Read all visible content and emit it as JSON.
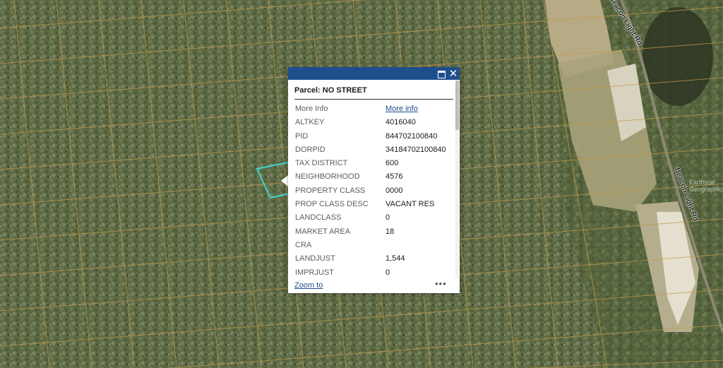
{
  "map": {
    "roads": [
      "Beacon Light Rd",
      "Beacon Light Rd"
    ],
    "credit": "Earthstar Geographics"
  },
  "popup": {
    "title": "Parcel: NO STREET",
    "rows": [
      {
        "key": "More Info",
        "value": "More info",
        "link": true
      },
      {
        "key": "ALTKEY",
        "value": "4016040"
      },
      {
        "key": "PID",
        "value": "844702100840"
      },
      {
        "key": "DORPID",
        "value": "34184702100840"
      },
      {
        "key": "TAX DISTRICT",
        "value": "600"
      },
      {
        "key": "NEIGHBORHOOD",
        "value": "4576"
      },
      {
        "key": "PROPERTY CLASS",
        "value": "0000"
      },
      {
        "key": "PROP CLASS DESC",
        "value": "VACANT RES"
      },
      {
        "key": "LANDCLASS",
        "value": "0"
      },
      {
        "key": "MARKET AREA",
        "value": "18"
      },
      {
        "key": "CRA",
        "value": ""
      },
      {
        "key": "LANDJUST",
        "value": "1,544"
      },
      {
        "key": "IMPRJUST",
        "value": "0"
      }
    ],
    "zoom_label": "Zoom to",
    "more_label": "•••"
  },
  "colors": {
    "header": "#1f4e8c",
    "parcel_lines": "#c49a4a",
    "selected_parcel": "#3fd6cf"
  }
}
